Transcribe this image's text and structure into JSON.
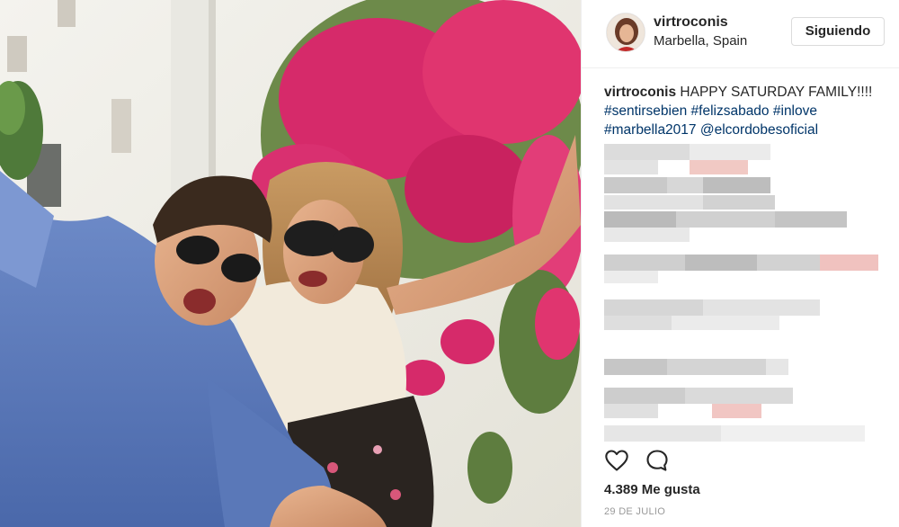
{
  "post": {
    "username": "virtroconis",
    "location": "Marbella, Spain",
    "follow_label": "Siguiendo",
    "caption": {
      "username": "virtroconis",
      "text": "HAPPY SATURDAY FAMILY!!!!",
      "tags": [
        "#sentirsebien",
        "#felizsabado",
        "#inlove",
        "#marbella2017",
        "@elcordobesoficial"
      ]
    },
    "likes": "4.389 Me gusta",
    "date": "29 DE JULIO"
  },
  "icons": {
    "like": "heart-icon",
    "comment": "comment-icon"
  },
  "colors": {
    "link": "#003569",
    "text": "#262626",
    "muted": "#999999",
    "border": "#efefef"
  }
}
